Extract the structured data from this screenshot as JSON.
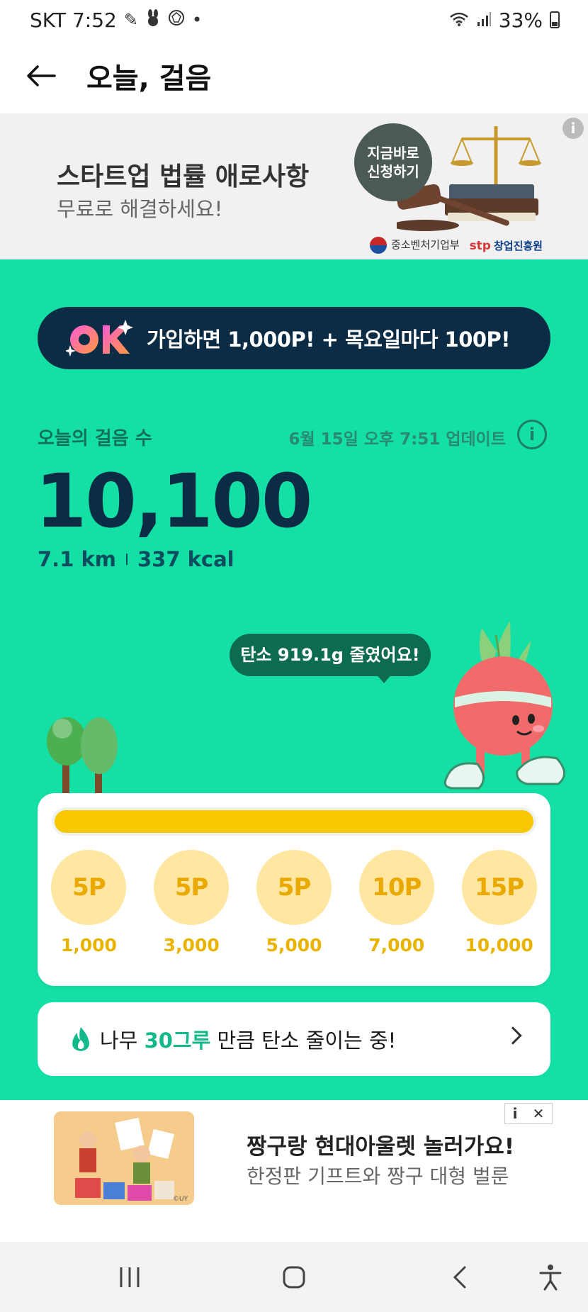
{
  "status_bar": {
    "time": "SKT 7:52",
    "battery": "33%",
    "notification_icons": [
      "app-notification-icon",
      "rabbit-icon",
      "gem-icon",
      "dot-icon"
    ],
    "right_icons": [
      "wifi-icon",
      "signal-icon",
      "battery-icon"
    ]
  },
  "header": {
    "title": "오늘, 걸음",
    "back_icon": "arrow-left-icon"
  },
  "top_ad": {
    "title": "스타트업 법률 애로사항",
    "subtitle": "무료로 해결하세요!",
    "bubble_line1": "지금바로",
    "bubble_line2": "신청하기",
    "sponsor_1": "중소벤처기업부",
    "sponsor_2_logo": "stp",
    "sponsor_2": "창업진흥원",
    "info_icon": "i"
  },
  "colors": {
    "main_bg": "#14e0a6",
    "navy": "#0b2c44",
    "progress": "#f7c700",
    "milestone_bg": "#ffe6a1",
    "milestone_text": "#e9a900",
    "highlight": "#12b98a"
  },
  "promo": {
    "text": "가입하면 1,000P! + 목요일마다 100P!",
    "logo": "OK"
  },
  "steps": {
    "label": "오늘의 걸음 수",
    "update_text": "6월 15일 오후 7:51 업데이트",
    "info_icon": "i",
    "count": "10,100",
    "distance": "7.1 km",
    "calories": "337 kcal"
  },
  "carbon_bubble": "탄소 919.1g 줄였어요!",
  "rewards": {
    "progress_fraction": 1.0,
    "milestones": [
      {
        "points": "5P",
        "steps": "1,000"
      },
      {
        "points": "5P",
        "steps": "3,000"
      },
      {
        "points": "5P",
        "steps": "5,000"
      },
      {
        "points": "10P",
        "steps": "7,000"
      },
      {
        "points": "15P",
        "steps": "10,000"
      }
    ]
  },
  "carbon_row": {
    "prefix": "나무 ",
    "highlight": "30그루",
    "suffix": " 만큼 탄소 줄이는 중!",
    "icon": "flame-icon"
  },
  "bottom_ad": {
    "title": "짱구랑 현대아울렛 놀러가요!",
    "subtitle": "한정판 기프트와 짱구 대형 벌룬",
    "thumb_mark": "©UY",
    "adchoices_info": "i",
    "adchoices_close": "✕"
  },
  "nav": {
    "icons": [
      "recent-apps-icon",
      "home-icon",
      "back-icon",
      "accessibility-icon"
    ]
  }
}
